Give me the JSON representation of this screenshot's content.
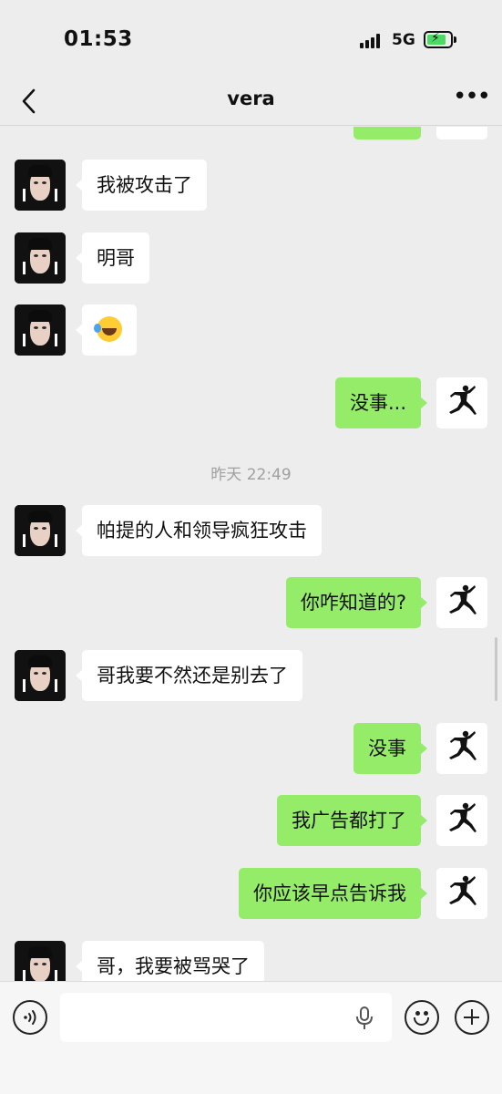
{
  "status_bar": {
    "time": "01:53",
    "network": "5G"
  },
  "nav": {
    "title": "vera",
    "back_icon": "chevron-left-icon",
    "more_icon": "more-dots-icon",
    "more_label": "•••"
  },
  "messages": [
    {
      "side": "left",
      "text": "我被攻击了"
    },
    {
      "side": "left",
      "text": "明哥"
    },
    {
      "side": "left",
      "emoji": "rolling-laughing-emoji"
    },
    {
      "side": "right",
      "text": "没事..."
    },
    {
      "timestamp": "昨天 22:49"
    },
    {
      "side": "left",
      "text": "帕提的人和领导疯狂攻击"
    },
    {
      "side": "right",
      "text": "你咋知道的?"
    },
    {
      "side": "left",
      "text": "哥我要不然还是别去了"
    },
    {
      "side": "right",
      "text": "没事"
    },
    {
      "side": "right",
      "text": "我广告都打了"
    },
    {
      "side": "right",
      "text": "你应该早点告诉我"
    },
    {
      "side": "left",
      "text": "哥，我要被骂哭了"
    }
  ],
  "input_bar": {
    "placeholder": "",
    "value": ""
  },
  "colors": {
    "background": "#ededed",
    "outgoing_bubble": "#95ec69",
    "incoming_bubble": "#ffffff",
    "timestamp": "#a0a0a0"
  }
}
